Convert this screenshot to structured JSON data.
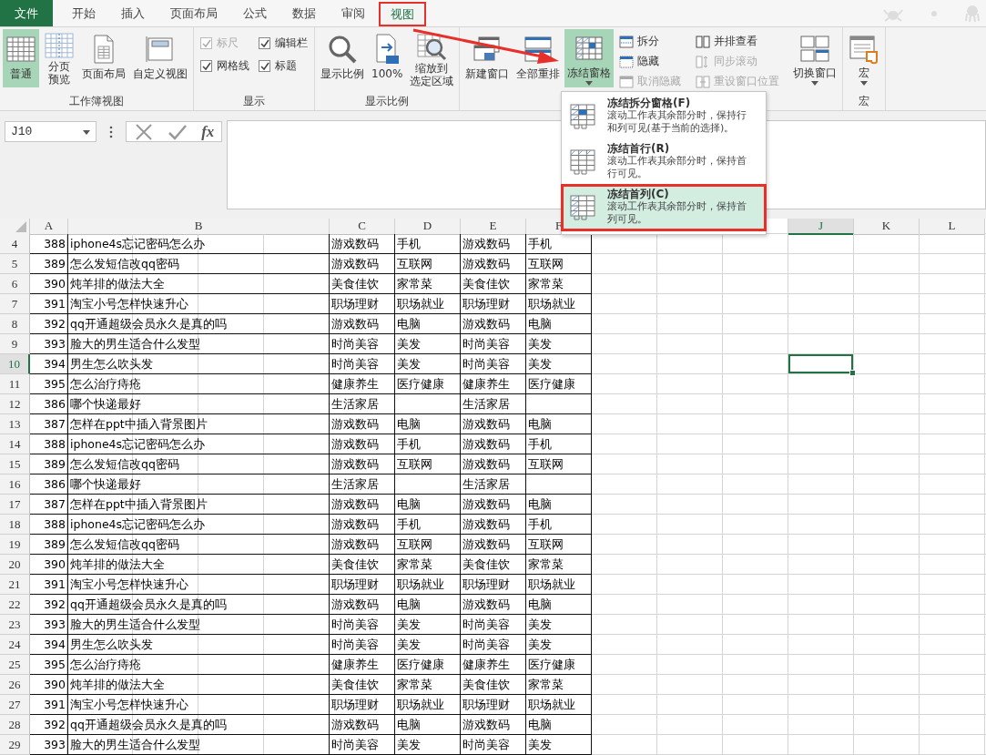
{
  "tabs": [
    {
      "label": "文件",
      "kind": "file",
      "selected": false,
      "highlighted": false
    },
    {
      "label": "开始",
      "kind": "tab",
      "selected": false,
      "highlighted": false
    },
    {
      "label": "插入",
      "kind": "tab",
      "selected": false,
      "highlighted": false
    },
    {
      "label": "页面布局",
      "kind": "tab",
      "selected": false,
      "highlighted": false
    },
    {
      "label": "公式",
      "kind": "tab",
      "selected": false,
      "highlighted": false
    },
    {
      "label": "数据",
      "kind": "tab",
      "selected": false,
      "highlighted": false
    },
    {
      "label": "审阅",
      "kind": "tab",
      "selected": false,
      "highlighted": false
    },
    {
      "label": "视图",
      "kind": "tab",
      "selected": true,
      "highlighted": true
    }
  ],
  "ribbon": {
    "groups": [
      {
        "label": "工作簿视图",
        "items": [
          {
            "kind": "large",
            "label_lines": [
              "普通"
            ],
            "selected": true,
            "dropdown": false
          },
          {
            "kind": "large",
            "label_lines": [
              "分页",
              "预览"
            ],
            "selected": false,
            "dropdown": false
          },
          {
            "kind": "large",
            "label_lines": [
              "页面布局"
            ],
            "selected": false,
            "dropdown": false
          },
          {
            "kind": "large",
            "label_lines": [
              "自定义视图"
            ],
            "selected": false,
            "dropdown": false
          }
        ]
      },
      {
        "label": "显示",
        "items": [
          {
            "kind": "stack",
            "items": [
              {
                "kind": "check",
                "label": "标尺",
                "checked": true,
                "disabled": true
              },
              {
                "kind": "check",
                "label": "网格线",
                "checked": true,
                "disabled": false
              }
            ]
          },
          {
            "kind": "stack",
            "items": [
              {
                "kind": "check",
                "label": "编辑栏",
                "checked": true,
                "disabled": false
              },
              {
                "kind": "check",
                "label": "标题",
                "checked": true,
                "disabled": false
              }
            ]
          }
        ]
      },
      {
        "label": "显示比例",
        "items": [
          {
            "kind": "large",
            "label_lines": [
              "显示比例"
            ],
            "selected": false,
            "dropdown": false
          },
          {
            "kind": "large",
            "label_lines": [
              "100%"
            ],
            "selected": false,
            "dropdown": false
          },
          {
            "kind": "large",
            "label_lines": [
              "缩放到",
              "选定区域"
            ],
            "selected": false,
            "dropdown": false
          }
        ]
      },
      {
        "items": [
          {
            "kind": "large",
            "label_lines": [
              "新建窗口"
            ],
            "selected": false,
            "dropdown": false
          },
          {
            "kind": "large",
            "label_lines": [
              "全部重排"
            ],
            "selected": false,
            "dropdown": false
          },
          {
            "kind": "large",
            "label_lines": [
              "冻结窗格"
            ],
            "selected": true,
            "dropdown": true
          },
          {
            "kind": "stack",
            "items": [
              {
                "kind": "small",
                "label": "拆分",
                "disabled": false
              },
              {
                "kind": "small",
                "label": "隐藏",
                "disabled": false
              },
              {
                "kind": "small",
                "label": "取消隐藏",
                "disabled": true
              }
            ]
          },
          {
            "kind": "stack",
            "items": [
              {
                "kind": "small",
                "label": "并排查看",
                "disabled": false
              },
              {
                "kind": "small",
                "label": "同步滚动",
                "disabled": true
              },
              {
                "kind": "small",
                "label": "重设窗口位置",
                "disabled": true
              }
            ]
          },
          {
            "kind": "large",
            "label_lines": [
              "切换窗口"
            ],
            "selected": false,
            "dropdown": true
          }
        ]
      },
      {
        "label": "宏",
        "items": [
          {
            "kind": "large",
            "label_lines": [
              "宏"
            ],
            "selected": false,
            "dropdown": true
          }
        ]
      }
    ]
  },
  "formula_bar": {
    "name_box": "J10",
    "buttons": [
      "fx"
    ]
  },
  "freeze_menu": [
    {
      "title": "冻结拆分窗格(F)",
      "description": "滚动工作表其余部分时，保持行和列可见(基于当前的选择)。",
      "selected": false,
      "highlighted": false
    },
    {
      "title": "冻结首行(R)",
      "description": "滚动工作表其余部分时，保持首行可见。",
      "selected": false,
      "highlighted": false
    },
    {
      "title": "冻结首列(C)",
      "description": "滚动工作表其余部分时，保持首列可见。",
      "selected": true,
      "highlighted": true
    }
  ],
  "sheet": {
    "columns": [
      {
        "label": "A",
        "selected": false
      },
      {
        "label": "B",
        "selected": false
      },
      {
        "label": "C",
        "selected": false
      },
      {
        "label": "D",
        "selected": false
      },
      {
        "label": "E",
        "selected": false
      },
      {
        "label": "F",
        "selected": false
      },
      null,
      null,
      null,
      {
        "label": "J",
        "selected": true
      },
      {
        "label": "K",
        "selected": false
      },
      {
        "label": "L",
        "selected": false
      }
    ],
    "rows": [
      {
        "row": "4",
        "selected": false,
        "cells": [
          "388",
          "iphone4s忘记密码怎么办",
          "游戏数码",
          "手机",
          "游戏数码",
          "手机"
        ]
      },
      {
        "row": "5",
        "selected": false,
        "cells": [
          "389",
          "怎么发短信改qq密码",
          "游戏数码",
          "互联网",
          "游戏数码",
          "互联网"
        ]
      },
      {
        "row": "6",
        "selected": false,
        "cells": [
          "390",
          "炖羊排的做法大全",
          "美食佳饮",
          "家常菜",
          "美食佳饮",
          "家常菜"
        ]
      },
      {
        "row": "7",
        "selected": false,
        "cells": [
          "391",
          "淘宝小号怎样快速升心",
          "职场理财",
          "职场就业",
          "职场理财",
          "职场就业"
        ]
      },
      {
        "row": "8",
        "selected": false,
        "cells": [
          "392",
          "qq开通超级会员永久是真的吗",
          "游戏数码",
          "电脑",
          "游戏数码",
          "电脑"
        ]
      },
      {
        "row": "9",
        "selected": false,
        "cells": [
          "393",
          "脸大的男生适合什么发型",
          "时尚美容",
          "美发",
          "时尚美容",
          "美发"
        ]
      },
      {
        "row": "10",
        "selected": true,
        "cells": [
          "394",
          "男生怎么吹头发",
          "时尚美容",
          "美发",
          "时尚美容",
          "美发"
        ]
      },
      {
        "row": "11",
        "selected": false,
        "cells": [
          "395",
          "怎么治疗痔疮",
          "健康养生",
          "医疗健康",
          "健康养生",
          "医疗健康"
        ]
      },
      {
        "row": "12",
        "selected": false,
        "cells": [
          "386",
          "哪个快递最好",
          "生活家居",
          null,
          "生活家居",
          null
        ]
      },
      {
        "row": "13",
        "selected": false,
        "cells": [
          "387",
          "怎样在ppt中插入背景图片",
          "游戏数码",
          "电脑",
          "游戏数码",
          "电脑"
        ]
      },
      {
        "row": "14",
        "selected": false,
        "cells": [
          "388",
          "iphone4s忘记密码怎么办",
          "游戏数码",
          "手机",
          "游戏数码",
          "手机"
        ]
      },
      {
        "row": "15",
        "selected": false,
        "cells": [
          "389",
          "怎么发短信改qq密码",
          "游戏数码",
          "互联网",
          "游戏数码",
          "互联网"
        ]
      },
      {
        "row": "16",
        "selected": false,
        "cells": [
          "386",
          "哪个快递最好",
          "生活家居",
          null,
          "生活家居",
          null
        ]
      },
      {
        "row": "17",
        "selected": false,
        "cells": [
          "387",
          "怎样在ppt中插入背景图片",
          "游戏数码",
          "电脑",
          "游戏数码",
          "电脑"
        ]
      },
      {
        "row": "18",
        "selected": false,
        "cells": [
          "388",
          "iphone4s忘记密码怎么办",
          "游戏数码",
          "手机",
          "游戏数码",
          "手机"
        ]
      },
      {
        "row": "19",
        "selected": false,
        "cells": [
          "389",
          "怎么发短信改qq密码",
          "游戏数码",
          "互联网",
          "游戏数码",
          "互联网"
        ]
      },
      {
        "row": "20",
        "selected": false,
        "cells": [
          "390",
          "炖羊排的做法大全",
          "美食佳饮",
          "家常菜",
          "美食佳饮",
          "家常菜"
        ]
      },
      {
        "row": "21",
        "selected": false,
        "cells": [
          "391",
          "淘宝小号怎样快速升心",
          "职场理财",
          "职场就业",
          "职场理财",
          "职场就业"
        ]
      },
      {
        "row": "22",
        "selected": false,
        "cells": [
          "392",
          "qq开通超级会员永久是真的吗",
          "游戏数码",
          "电脑",
          "游戏数码",
          "电脑"
        ]
      },
      {
        "row": "23",
        "selected": false,
        "cells": [
          "393",
          "脸大的男生适合什么发型",
          "时尚美容",
          "美发",
          "时尚美容",
          "美发"
        ]
      },
      {
        "row": "24",
        "selected": false,
        "cells": [
          "394",
          "男生怎么吹头发",
          "时尚美容",
          "美发",
          "时尚美容",
          "美发"
        ]
      },
      {
        "row": "25",
        "selected": false,
        "cells": [
          "395",
          "怎么治疗痔疮",
          "健康养生",
          "医疗健康",
          "健康养生",
          "医疗健康"
        ]
      },
      {
        "row": "26",
        "selected": false,
        "cells": [
          "390",
          "炖羊排的做法大全",
          "美食佳饮",
          "家常菜",
          "美食佳饮",
          "家常菜"
        ]
      },
      {
        "row": "27",
        "selected": false,
        "cells": [
          "391",
          "淘宝小号怎样快速升心",
          "职场理财",
          "职场就业",
          "职场理财",
          "职场就业"
        ]
      },
      {
        "row": "28",
        "selected": false,
        "cells": [
          "392",
          "qq开通超级会员永久是真的吗",
          "游戏数码",
          "电脑",
          "游戏数码",
          "电脑"
        ]
      },
      {
        "row": "29",
        "selected": false,
        "cells": [
          "393",
          "脸大的男生适合什么发型",
          "时尚美容",
          "美发",
          "时尚美容",
          "美发"
        ]
      }
    ]
  }
}
